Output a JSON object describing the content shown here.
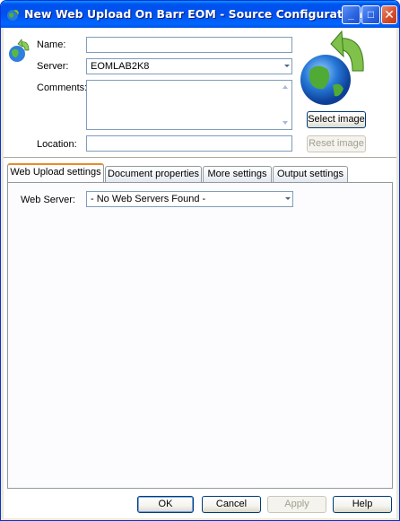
{
  "window": {
    "title": "New Web Upload On Barr EOM - Source Configuration",
    "title_icon": "globe-arrow-icon",
    "controls": {
      "minimize": "_",
      "maximize": "□",
      "close": "✕"
    }
  },
  "form": {
    "name": {
      "label": "Name:",
      "value": ""
    },
    "server": {
      "label": "Server:",
      "value": "EOMLAB2K8"
    },
    "comments": {
      "label": "Comments:",
      "value": ""
    },
    "location": {
      "label": "Location:",
      "value": ""
    }
  },
  "image_panel": {
    "icon": "globe-arrow-icon",
    "select_label": "Select image",
    "reset_label": "Reset image"
  },
  "tabs": [
    {
      "label": "Web Upload settings",
      "active": true
    },
    {
      "label": "Document properties",
      "active": false
    },
    {
      "label": "More settings",
      "active": false
    },
    {
      "label": "Output settings",
      "active": false
    }
  ],
  "web_upload": {
    "web_server_label": "Web Server:",
    "web_server_value": "- No Web Servers Found -"
  },
  "buttons": {
    "ok": "OK",
    "cancel": "Cancel",
    "apply": "Apply",
    "help": "Help"
  },
  "colors": {
    "title_bar": "#0053ee",
    "window_frame": "#0831d9",
    "active_tab_accent": "#e68b2c",
    "field_border": "#7f9db9"
  }
}
